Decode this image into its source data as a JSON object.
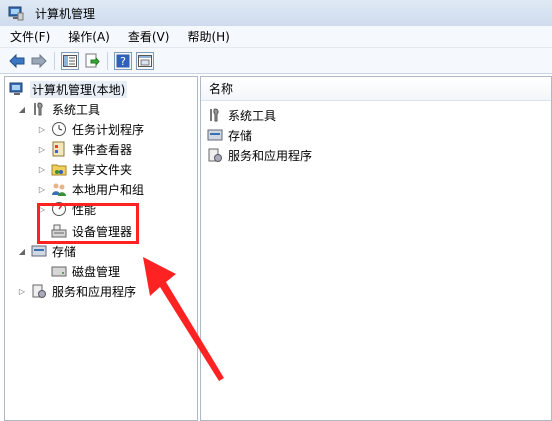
{
  "window": {
    "title": "计算机管理"
  },
  "menu": [
    "文件(F)",
    "操作(A)",
    "查看(V)",
    "帮助(H)"
  ],
  "toolbar": {
    "icons": [
      "back-arrow-icon",
      "forward-arrow-icon",
      "show-hide-tree-icon",
      "export-list-icon",
      "help-icon",
      "properties-icon"
    ]
  },
  "tree": {
    "root": "计算机管理(本地)",
    "system_tools": {
      "label": "系统工具",
      "children": [
        "任务计划程序",
        "事件查看器",
        "共享文件夹",
        "本地用户和组",
        "性能",
        "设备管理器"
      ]
    },
    "storage": {
      "label": "存储",
      "children": [
        "磁盘管理"
      ]
    },
    "services": "服务和应用程序"
  },
  "right": {
    "column_header": "名称",
    "rows": [
      "系统工具",
      "存储",
      "服务和应用程序"
    ]
  },
  "annotation": {
    "color": "#ff2222",
    "icon": "red-arrow-icon"
  }
}
